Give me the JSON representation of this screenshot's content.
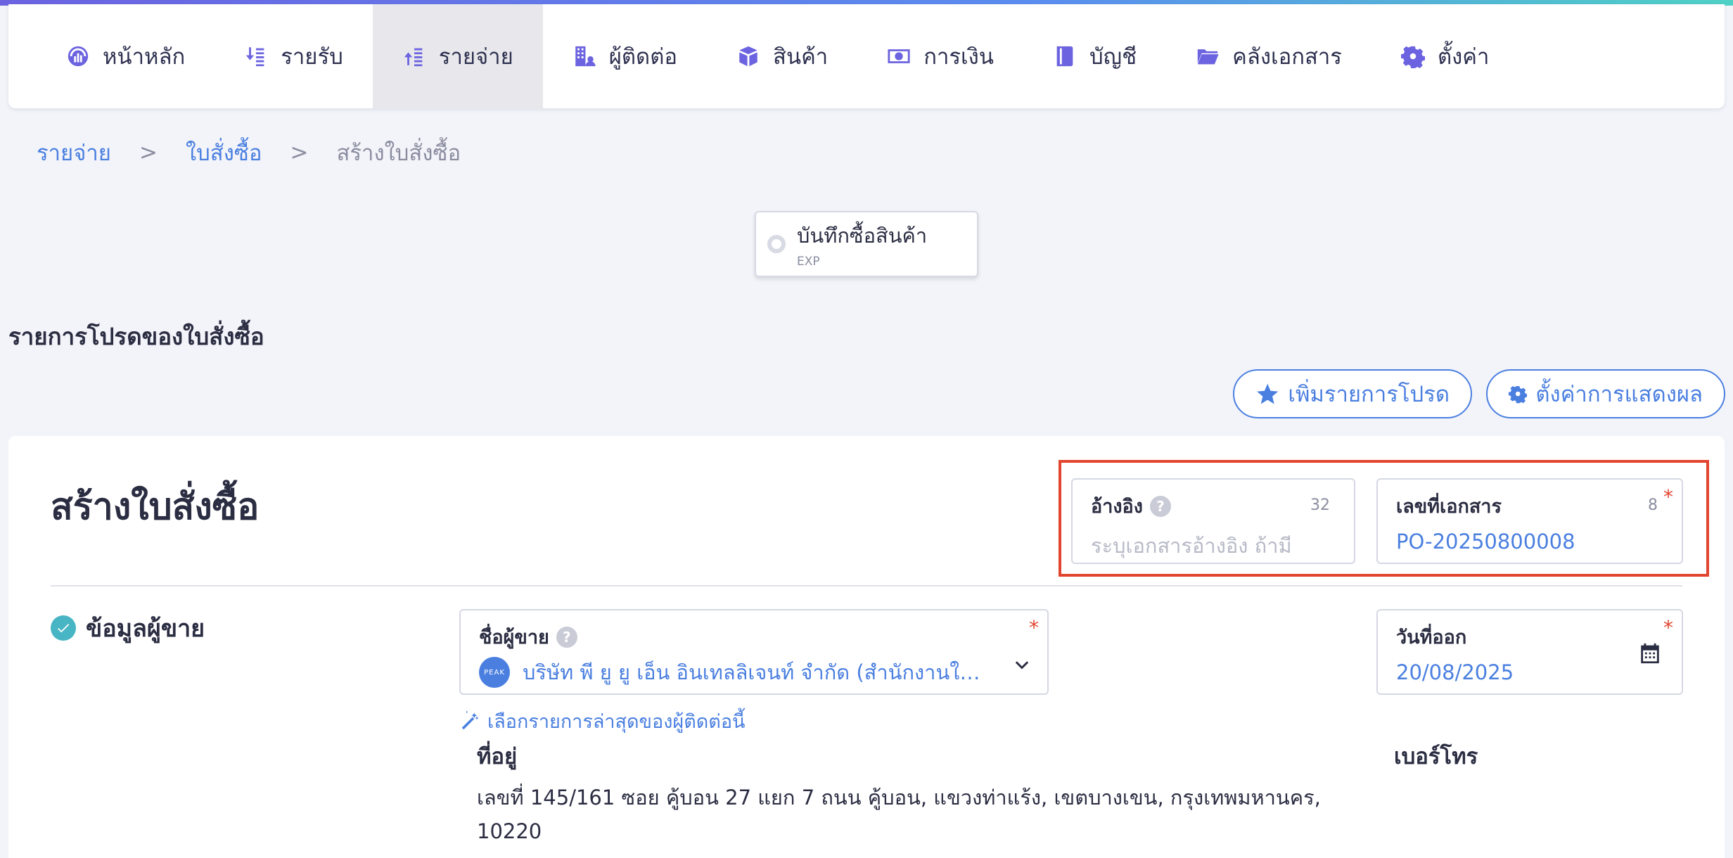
{
  "nav": {
    "items": [
      {
        "label": "หน้าหลัก",
        "icon": "dashboard-icon",
        "active": false
      },
      {
        "label": "รายรับ",
        "icon": "income-icon",
        "active": false
      },
      {
        "label": "รายจ่าย",
        "icon": "expense-icon",
        "active": true
      },
      {
        "label": "ผู้ติดต่อ",
        "icon": "contacts-icon",
        "active": false
      },
      {
        "label": "สินค้า",
        "icon": "box-icon",
        "active": false
      },
      {
        "label": "การเงิน",
        "icon": "money-icon",
        "active": false
      },
      {
        "label": "บัญชี",
        "icon": "ledger-icon",
        "active": false
      },
      {
        "label": "คลังเอกสาร",
        "icon": "folder-icon",
        "active": false
      },
      {
        "label": "ตั้งค่า",
        "icon": "gear-icon",
        "active": false
      }
    ]
  },
  "breadcrumb": {
    "level1": "รายจ่าย",
    "sep": ">",
    "level2": "ใบสั่งซื้อ",
    "current": "สร้างใบสั่งซื้อ"
  },
  "doc_type": {
    "title": "บันทึกซื้อสินค้า",
    "code": "EXP"
  },
  "favorites": {
    "heading": "รายการโปรดของใบสั่งซื้อ",
    "add_button": "เพิ่มรายการโปรด",
    "display_button": "ตั้งค่าการแสดงผล"
  },
  "form": {
    "title": "สร้างใบสั่งซื้อ",
    "reference": {
      "label": "อ้างอิง",
      "count": "32",
      "placeholder": "ระบุเอกสารอ้างอิง ถ้ามี"
    },
    "doc_number": {
      "label": "เลขที่เอกสาร",
      "count": "8",
      "required": "*",
      "value": "PO-20250800008"
    },
    "seller_section": {
      "title": "ข้อมูลผู้ขาย"
    },
    "seller": {
      "label": "ชื่อผู้ขาย",
      "required": "*",
      "logo_text": "PEAK",
      "value": "บริษัท พี ยู ยู เอ็น อินเทลลิเจนท์ จำกัด (สำนักงานให..."
    },
    "issue_date": {
      "label": "วันที่ออก",
      "required": "*",
      "value": "20/08/2025"
    },
    "latest_link": "เลือกรายการล่าสุดของผู้ติดต่อนี้",
    "address_label": "ที่อยู่",
    "phone_label": "เบอร์โทร",
    "address_text": "เลขที่ 145/161 ซอย คู้บอน 27 แยก 7 ถนน คู้บอน, แขวงท่าแร้ง, เขตบางเขน, กรุงเทพมหานคร, 10220"
  },
  "colors": {
    "accent": "#6c63e0",
    "link": "#4a7fe0",
    "highlight": "#e2452f",
    "check": "#48b5c4"
  }
}
